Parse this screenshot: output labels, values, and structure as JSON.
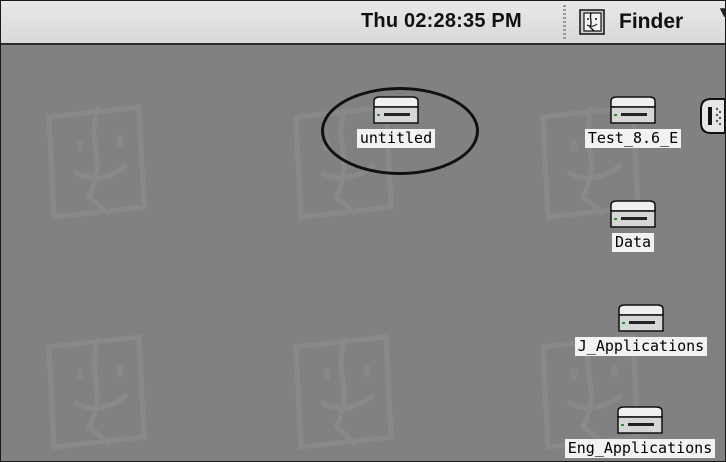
{
  "menubar": {
    "clock": "Thu 02:28:35 PM",
    "app_name": "Finder",
    "app_icon": "finder-icon"
  },
  "desktop": {
    "volumes": [
      {
        "label": "untitled",
        "icon": "hard-disk-icon",
        "selected_circle": true
      },
      {
        "label": "Test_8.6_E",
        "icon": "hard-disk-icon"
      },
      {
        "label": "Data",
        "icon": "hard-disk-icon"
      },
      {
        "label": "J_Applications",
        "icon": "hard-disk-icon"
      },
      {
        "label": "Eng_Applications",
        "icon": "hard-disk-icon"
      }
    ]
  },
  "colors": {
    "desktop": "#818181",
    "menubar": "#dddddd",
    "annotation": "#111111"
  }
}
